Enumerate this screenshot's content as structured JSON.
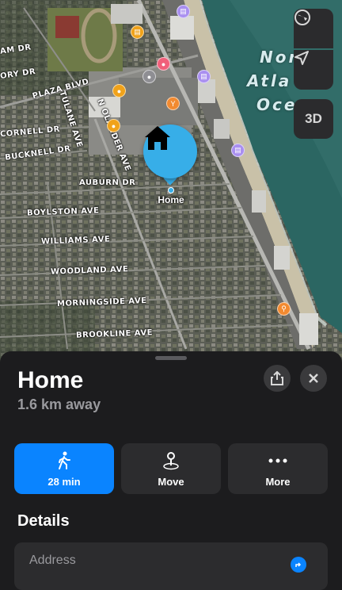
{
  "map": {
    "ocean_label_lines": [
      "Nor",
      "Atla",
      "Oce"
    ],
    "streets": {
      "am_dr": "AM DR",
      "ory_dr": "ORY DR",
      "plaza_blvd": "PLAZA BLVD",
      "tulane_ave": "TULANE AVE",
      "cornell_dr": "CORNELL DR",
      "bucknell_dr": "BUCKNELL DR",
      "nolander_ave": "N OLANDER AVE",
      "auburn_dr": "AUBURN DR",
      "boylston_ave": "BOYLSTON AVE",
      "williams_ave": "WILLIAMS AVE",
      "woodland_ave": "WOODLAND AVE",
      "morningside_ave": "MORNINGSIDE AVE",
      "brookline_ave": "BROOKLINE AVE"
    },
    "controls": {
      "globe_icon": "globe-icon",
      "location_icon": "location-arrow-icon",
      "three_d": "3D"
    },
    "pin_label": "Home",
    "colors": {
      "pin": "#37aee8",
      "hotel_poi": "#a98ff0",
      "shop_poi": "#f0a21a",
      "food_poi": "#f28a30",
      "pink_poi": "#f0607a"
    }
  },
  "sheet": {
    "title": "Home",
    "subtitle": "1.6 km away",
    "actions": [
      {
        "label": "28 min",
        "icon": "walking-icon",
        "color": "#0a84ff"
      },
      {
        "label": "Move",
        "icon": "move-pin-icon"
      },
      {
        "label": "More",
        "icon": "ellipsis-icon"
      }
    ],
    "details_heading": "Details",
    "address_label": "Address"
  }
}
